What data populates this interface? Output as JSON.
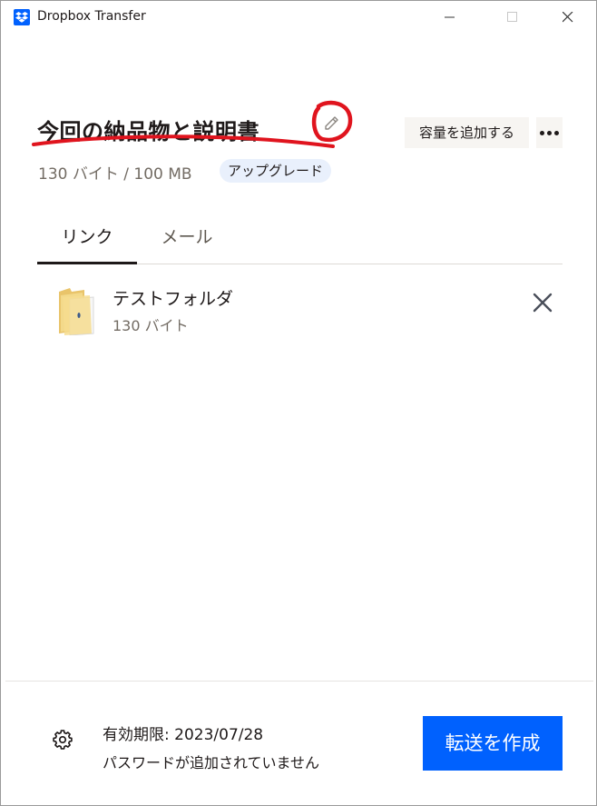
{
  "window": {
    "app_title": "Dropbox Transfer"
  },
  "header": {
    "transfer_title": "今回の納品物と説明書",
    "size_info": "130 バイト / 100 MB",
    "upgrade_label": "アップグレード",
    "add_capacity_label": "容量を追加する"
  },
  "tabs": [
    {
      "label": "リンク",
      "active": true
    },
    {
      "label": "メール",
      "active": false
    }
  ],
  "files": [
    {
      "name": "テストフォルダ",
      "size": "130 バイト",
      "icon": "folder-icon"
    }
  ],
  "footer": {
    "expiry": "有効期限: 2023/07/28",
    "password_status": "パスワードが追加されていません",
    "create_label": "転送を作成"
  },
  "colors": {
    "accent": "#0061fe",
    "annotation": "#e0141e",
    "badge_bg": "#e9f0fc",
    "secondary_btn_bg": "#f7f5f2"
  }
}
